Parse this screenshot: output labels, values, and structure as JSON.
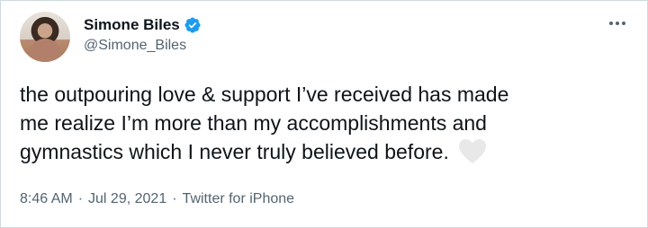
{
  "author": {
    "display_name": "Simone Biles",
    "handle": "@Simone_Biles",
    "verified": true,
    "verified_color": "#1d9bf0"
  },
  "tweet": {
    "text_lines": [
      "the outpouring love & support I’ve received has made",
      "me realize I’m more than my accomplishments and",
      "gymnastics which I never truly believed before."
    ],
    "emoji": "white-heart-icon"
  },
  "meta": {
    "time": "8:46 AM",
    "date": "Jul 29, 2021",
    "source": "Twitter for iPhone",
    "separator": "·"
  },
  "icons": {
    "more": "more-options-icon",
    "verified": "verified-badge-icon"
  }
}
